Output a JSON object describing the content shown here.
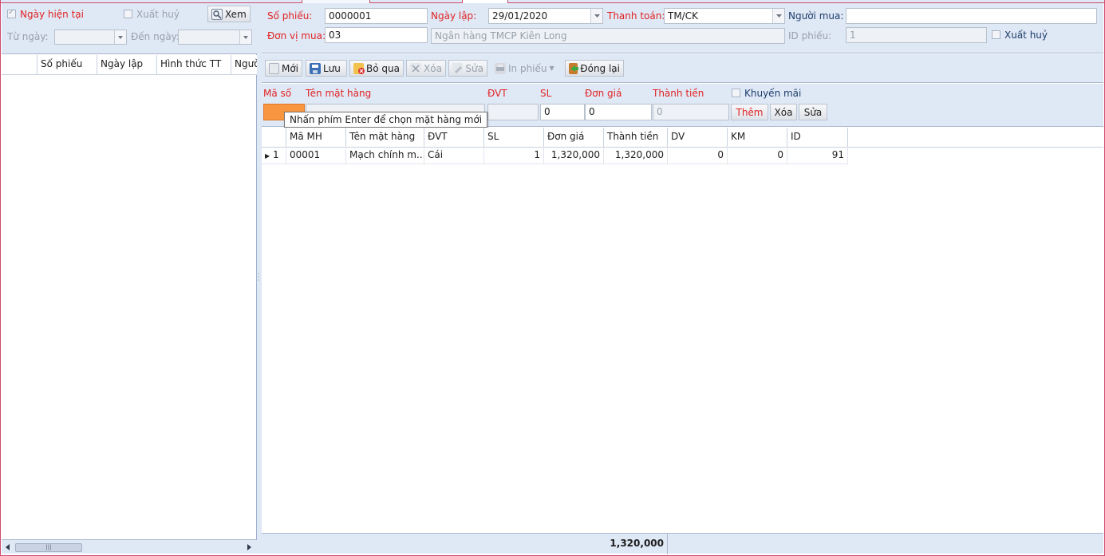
{
  "left": {
    "filter": {
      "current_date_label": "Ngày hiện tại",
      "cancelled_label": "Xuất huỷ",
      "view_button": "Xem",
      "from_label": "Từ ngày:",
      "to_label": "Đến ngày:"
    },
    "columns": [
      "Số phiếu",
      "Ngày lập",
      "Hình thức TT",
      "Người"
    ]
  },
  "header": {
    "voucher_no_label": "Số phiếu:",
    "voucher_no": "0000001",
    "date_label": "Ngày lập:",
    "date": "29/01/2020",
    "payment_label": "Thanh toán:",
    "payment": "TM/CK",
    "buyer_label": "Người mua:",
    "buyer": "",
    "unit_label": "Đơn vị mua:",
    "unit_code": "03",
    "unit_name": "Ngân hàng TMCP Kiên Long",
    "id_label": "ID phiếu:",
    "id_value": "1",
    "cancelled_label": "Xuất huỷ"
  },
  "toolbar": {
    "new": "Mới",
    "save": "Lưu",
    "skip": "Bỏ qua",
    "delete": "Xóa",
    "edit": "Sửa",
    "print": "In phiếu",
    "close": "Đóng lại"
  },
  "entry": {
    "code_label": "Mã số",
    "name_label": "Tên mặt hàng",
    "unit_label": "ĐVT",
    "qty_label": "SL",
    "price_label": "Đơn giá",
    "amount_label": "Thành tiền",
    "promo_label": "Khuyến mãi",
    "qty_value": "0",
    "price_value": "0",
    "amount_value": "0",
    "add_button": "Thêm",
    "delete_button": "Xóa",
    "edit_button": "Sửa",
    "tooltip": "Nhấn phím Enter để chọn mặt hàng mới"
  },
  "detail": {
    "columns": [
      "Mã MH",
      "Tên mặt hàng",
      "ĐVT",
      "SL",
      "Đơn giá",
      "Thành tiền",
      "DV",
      "KM",
      "ID"
    ],
    "rows": [
      {
        "index": "1",
        "code": "00001",
        "name": "Mạch chính m...",
        "unit": "Cái",
        "qty": "1",
        "price": "1,320,000",
        "amount": "1,320,000",
        "dv": "0",
        "km": "0",
        "id": "91"
      }
    ],
    "total": "1,320,000"
  },
  "colors": {
    "panel_bg": "#dfe8f5",
    "label_red": "#e02323",
    "code_input": "#f7963f"
  }
}
